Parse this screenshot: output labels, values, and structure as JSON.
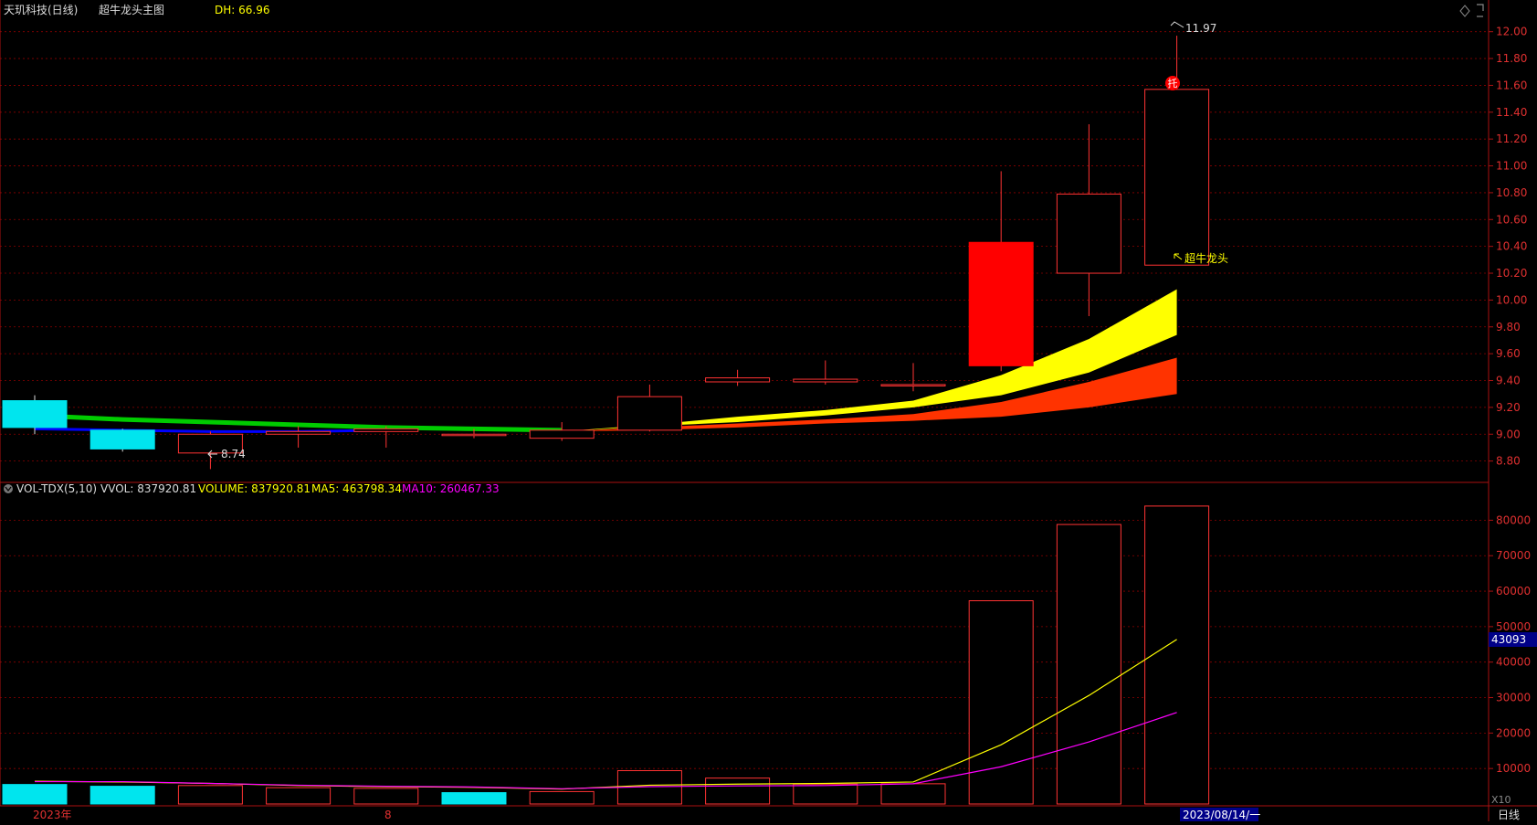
{
  "header": {
    "stock_name": "天玑科技(日线)",
    "indicator_name": "超牛龙头主图",
    "dh_label": "DH: 66.96"
  },
  "volume_header": {
    "indicator": "VOL-TDX(5,10)",
    "vvol": "VVOL: 837920.81",
    "volume": "VOLUME: 837920.81",
    "ma5": "MA5: 463798.34",
    "ma10": "MA10: 260467.33"
  },
  "annotations": {
    "high_label": "11.97",
    "low_label": "8.74",
    "signal_label": "超牛龙头",
    "tuo_marker": "托",
    "volume_cursor": "43093",
    "x10_label": "X10",
    "date_start": "2023年",
    "month_label": "8",
    "date_end": "2023/08/14/一",
    "period": "日线"
  },
  "colors": {
    "up": "#ff3333",
    "down": "#00e5ee",
    "limit_up_fill": "#ff0000",
    "ma_yellow": "#ffff00",
    "ma_red": "#ff3300",
    "ma_green": "#00cc00",
    "ma_blue": "#0000ff",
    "vol_ma5": "#ffff00",
    "vol_ma10": "#ff00ff",
    "axis": "#aa1111",
    "grid": "#8b0000"
  },
  "chart_data": [
    {
      "type": "candlestick",
      "title": "天玑科技(日线)",
      "ylim": [
        8.6,
        12.1
      ],
      "yticks": [
        "12.00",
        "11.80",
        "11.60",
        "11.40",
        "11.20",
        "11.00",
        "10.80",
        "10.60",
        "10.40",
        "10.20",
        "10.00",
        "9.80",
        "9.60",
        "9.40",
        "9.20",
        "9.00",
        "8.80"
      ],
      "candles": [
        {
          "open": 9.25,
          "close": 9.05,
          "high": 9.29,
          "low": 9.0
        },
        {
          "open": 9.03,
          "close": 8.89,
          "high": 9.04,
          "low": 8.87
        },
        {
          "open": 8.86,
          "close": 9.0,
          "high": 9.02,
          "low": 8.74
        },
        {
          "open": 9.0,
          "close": 9.02,
          "high": 9.06,
          "low": 8.9
        },
        {
          "open": 9.02,
          "close": 9.04,
          "high": 9.06,
          "low": 8.9
        },
        {
          "open": 9.0,
          "close": 9.0,
          "high": 9.04,
          "low": 8.97
        },
        {
          "open": 8.97,
          "close": 9.03,
          "high": 9.09,
          "low": 8.95
        },
        {
          "open": 9.03,
          "close": 9.28,
          "high": 9.37,
          "low": 9.02
        },
        {
          "open": 9.39,
          "close": 9.42,
          "high": 9.48,
          "low": 9.36
        },
        {
          "open": 9.39,
          "close": 9.41,
          "high": 9.55,
          "low": 9.37
        },
        {
          "open": 9.36,
          "close": 9.37,
          "high": 9.53,
          "low": 9.32
        },
        {
          "open": 9.51,
          "close": 10.43,
          "high": 10.96,
          "low": 9.47
        },
        {
          "open": 10.2,
          "close": 10.79,
          "high": 11.31,
          "low": 9.88
        },
        {
          "open": 10.26,
          "close": 11.57,
          "high": 11.97,
          "low": 10.26
        }
      ],
      "yellow_band_upper": [
        null,
        null,
        null,
        null,
        null,
        null,
        9.02,
        9.07,
        9.13,
        9.18,
        9.25,
        9.44,
        9.71,
        10.08
      ],
      "yellow_band_lower": [
        null,
        null,
        null,
        null,
        null,
        null,
        9.02,
        9.06,
        9.09,
        9.14,
        9.2,
        9.29,
        9.46,
        9.74
      ],
      "red_band_upper": [
        null,
        null,
        null,
        null,
        null,
        null,
        9.02,
        9.05,
        9.08,
        9.11,
        9.15,
        9.24,
        9.39,
        9.57
      ],
      "red_band_lower": [
        null,
        null,
        null,
        null,
        null,
        null,
        9.02,
        9.03,
        9.05,
        9.08,
        9.1,
        9.13,
        9.2,
        9.3
      ],
      "green_ma": [
        9.14,
        9.11,
        9.09,
        9.07,
        9.05,
        9.04,
        9.03
      ],
      "blue_ma": [
        9.04,
        9.03,
        9.02,
        9.02,
        9.03
      ]
    },
    {
      "type": "bar",
      "title": "VOL-TDX(5,10)",
      "ylim": [
        0,
        85000
      ],
      "yticks": [
        "80000",
        "70000",
        "60000",
        "50000",
        "40000",
        "30000",
        "20000",
        "10000"
      ],
      "volumes": [
        5500,
        5000,
        5200,
        4600,
        4400,
        3200,
        3500,
        9400,
        7300,
        5600,
        5700,
        57300,
        78800,
        84000
      ],
      "volume_colors": [
        "down",
        "down",
        "up",
        "up",
        "up",
        "down",
        "up",
        "up",
        "up",
        "up",
        "up",
        "limit",
        "up",
        "up"
      ],
      "ma5": [
        6400,
        6200,
        5800,
        5200,
        4900,
        4700,
        4200,
        5300,
        5600,
        5800,
        6200,
        16700,
        30600,
        46400
      ],
      "ma10": [
        6300,
        6300,
        5800,
        5300,
        5000,
        4800,
        4300,
        4900,
        5100,
        5200,
        5700,
        10500,
        17500,
        25800
      ]
    }
  ]
}
